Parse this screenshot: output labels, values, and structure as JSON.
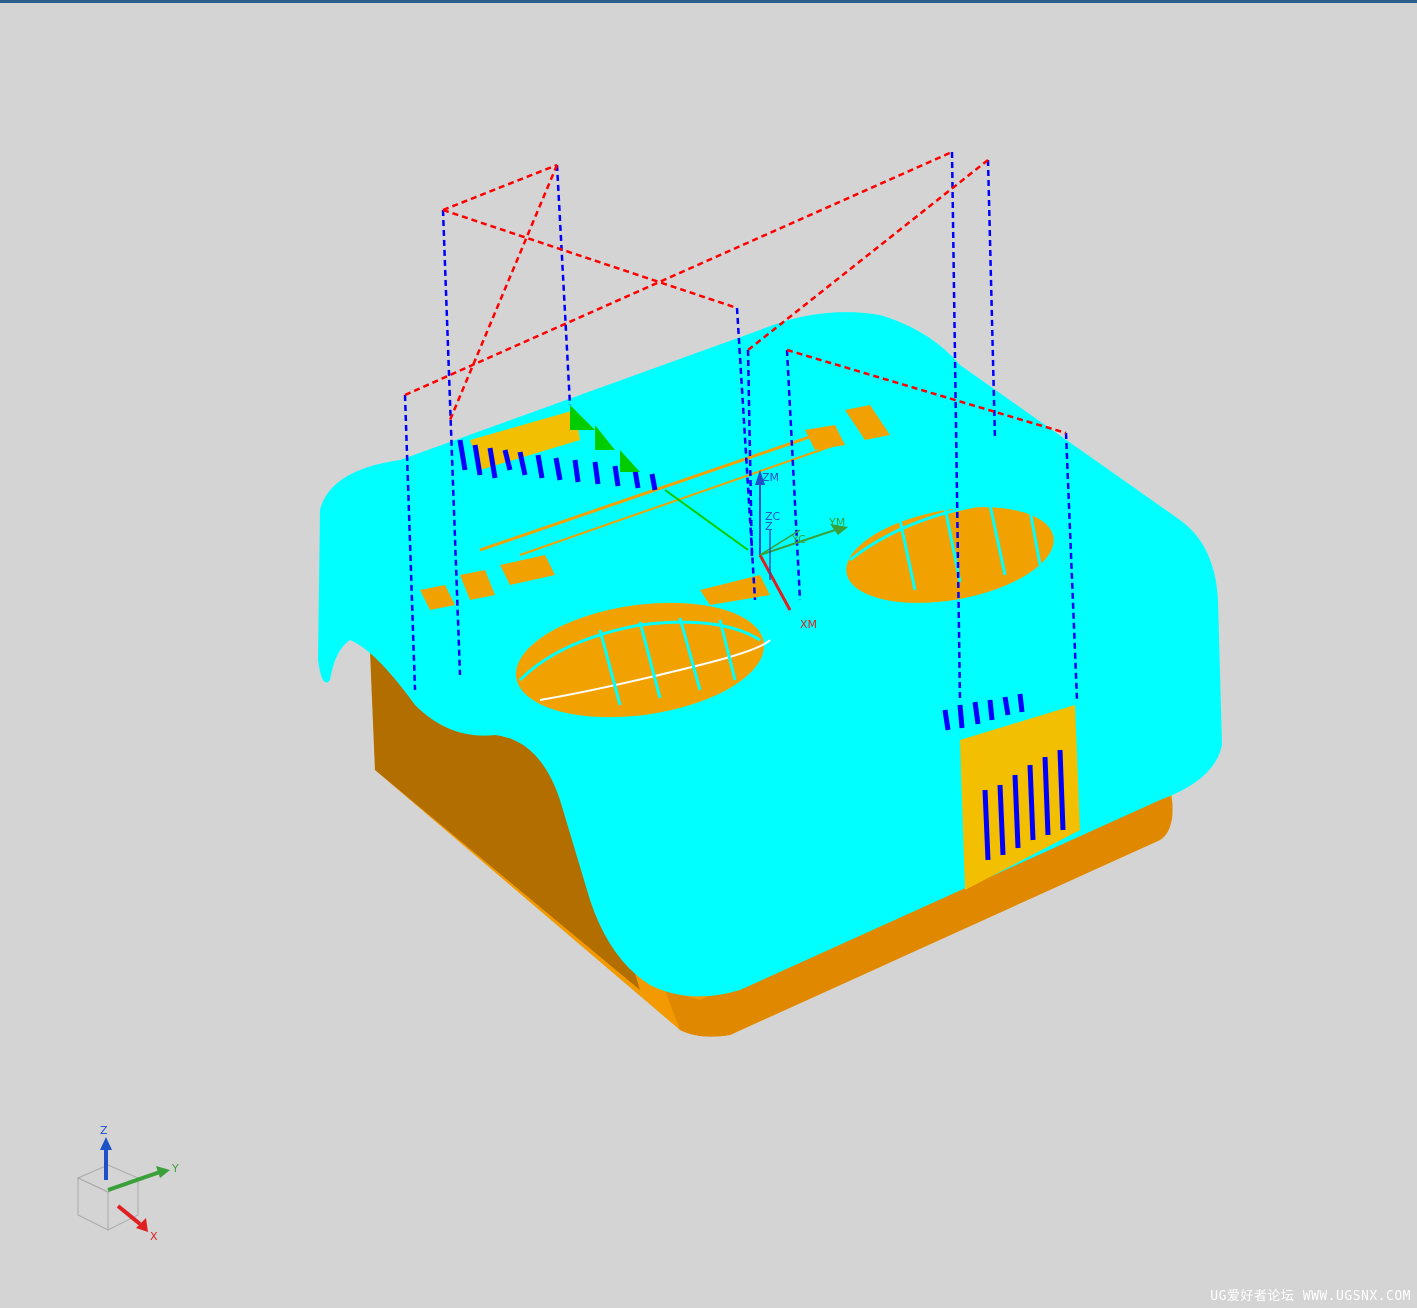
{
  "viewport": {
    "background": "#d4d4d4",
    "colors": {
      "surface": "#00ffff",
      "body": "#f29a00",
      "body_dark": "#b36e00",
      "cut_move": "#0000ff",
      "rapid_move": "#ff0000",
      "engage_move": "#00cc00",
      "wcs_z": "#1e50c8",
      "wcs_y": "#3aa03a",
      "wcs_x": "#e02020"
    },
    "wcs_labels": {
      "zm": "ZM",
      "zc": "ZC",
      "z": "Z",
      "yc": "YC",
      "ym": "YM",
      "y": "Y",
      "xm": "XM",
      "x": "X"
    }
  },
  "triad": {
    "z": "Z",
    "y": "Y",
    "x": "X"
  },
  "watermark": "UG爱好者论坛 WWW.UGSNX.COM"
}
